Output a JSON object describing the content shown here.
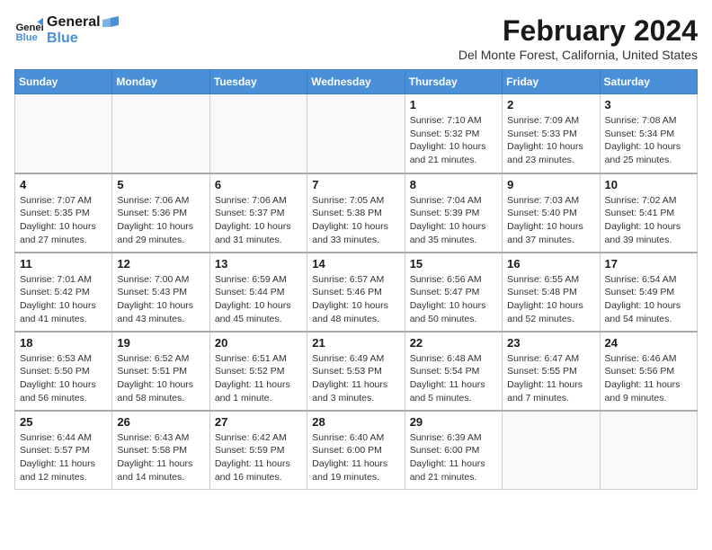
{
  "logo": {
    "line1": "General",
    "line2": "Blue"
  },
  "title": "February 2024",
  "location": "Del Monte Forest, California, United States",
  "weekdays": [
    "Sunday",
    "Monday",
    "Tuesday",
    "Wednesday",
    "Thursday",
    "Friday",
    "Saturday"
  ],
  "weeks": [
    [
      {
        "day": "",
        "info": ""
      },
      {
        "day": "",
        "info": ""
      },
      {
        "day": "",
        "info": ""
      },
      {
        "day": "",
        "info": ""
      },
      {
        "day": "1",
        "info": "Sunrise: 7:10 AM\nSunset: 5:32 PM\nDaylight: 10 hours\nand 21 minutes."
      },
      {
        "day": "2",
        "info": "Sunrise: 7:09 AM\nSunset: 5:33 PM\nDaylight: 10 hours\nand 23 minutes."
      },
      {
        "day": "3",
        "info": "Sunrise: 7:08 AM\nSunset: 5:34 PM\nDaylight: 10 hours\nand 25 minutes."
      }
    ],
    [
      {
        "day": "4",
        "info": "Sunrise: 7:07 AM\nSunset: 5:35 PM\nDaylight: 10 hours\nand 27 minutes."
      },
      {
        "day": "5",
        "info": "Sunrise: 7:06 AM\nSunset: 5:36 PM\nDaylight: 10 hours\nand 29 minutes."
      },
      {
        "day": "6",
        "info": "Sunrise: 7:06 AM\nSunset: 5:37 PM\nDaylight: 10 hours\nand 31 minutes."
      },
      {
        "day": "7",
        "info": "Sunrise: 7:05 AM\nSunset: 5:38 PM\nDaylight: 10 hours\nand 33 minutes."
      },
      {
        "day": "8",
        "info": "Sunrise: 7:04 AM\nSunset: 5:39 PM\nDaylight: 10 hours\nand 35 minutes."
      },
      {
        "day": "9",
        "info": "Sunrise: 7:03 AM\nSunset: 5:40 PM\nDaylight: 10 hours\nand 37 minutes."
      },
      {
        "day": "10",
        "info": "Sunrise: 7:02 AM\nSunset: 5:41 PM\nDaylight: 10 hours\nand 39 minutes."
      }
    ],
    [
      {
        "day": "11",
        "info": "Sunrise: 7:01 AM\nSunset: 5:42 PM\nDaylight: 10 hours\nand 41 minutes."
      },
      {
        "day": "12",
        "info": "Sunrise: 7:00 AM\nSunset: 5:43 PM\nDaylight: 10 hours\nand 43 minutes."
      },
      {
        "day": "13",
        "info": "Sunrise: 6:59 AM\nSunset: 5:44 PM\nDaylight: 10 hours\nand 45 minutes."
      },
      {
        "day": "14",
        "info": "Sunrise: 6:57 AM\nSunset: 5:46 PM\nDaylight: 10 hours\nand 48 minutes."
      },
      {
        "day": "15",
        "info": "Sunrise: 6:56 AM\nSunset: 5:47 PM\nDaylight: 10 hours\nand 50 minutes."
      },
      {
        "day": "16",
        "info": "Sunrise: 6:55 AM\nSunset: 5:48 PM\nDaylight: 10 hours\nand 52 minutes."
      },
      {
        "day": "17",
        "info": "Sunrise: 6:54 AM\nSunset: 5:49 PM\nDaylight: 10 hours\nand 54 minutes."
      }
    ],
    [
      {
        "day": "18",
        "info": "Sunrise: 6:53 AM\nSunset: 5:50 PM\nDaylight: 10 hours\nand 56 minutes."
      },
      {
        "day": "19",
        "info": "Sunrise: 6:52 AM\nSunset: 5:51 PM\nDaylight: 10 hours\nand 58 minutes."
      },
      {
        "day": "20",
        "info": "Sunrise: 6:51 AM\nSunset: 5:52 PM\nDaylight: 11 hours\nand 1 minute."
      },
      {
        "day": "21",
        "info": "Sunrise: 6:49 AM\nSunset: 5:53 PM\nDaylight: 11 hours\nand 3 minutes."
      },
      {
        "day": "22",
        "info": "Sunrise: 6:48 AM\nSunset: 5:54 PM\nDaylight: 11 hours\nand 5 minutes."
      },
      {
        "day": "23",
        "info": "Sunrise: 6:47 AM\nSunset: 5:55 PM\nDaylight: 11 hours\nand 7 minutes."
      },
      {
        "day": "24",
        "info": "Sunrise: 6:46 AM\nSunset: 5:56 PM\nDaylight: 11 hours\nand 9 minutes."
      }
    ],
    [
      {
        "day": "25",
        "info": "Sunrise: 6:44 AM\nSunset: 5:57 PM\nDaylight: 11 hours\nand 12 minutes."
      },
      {
        "day": "26",
        "info": "Sunrise: 6:43 AM\nSunset: 5:58 PM\nDaylight: 11 hours\nand 14 minutes."
      },
      {
        "day": "27",
        "info": "Sunrise: 6:42 AM\nSunset: 5:59 PM\nDaylight: 11 hours\nand 16 minutes."
      },
      {
        "day": "28",
        "info": "Sunrise: 6:40 AM\nSunset: 6:00 PM\nDaylight: 11 hours\nand 19 minutes."
      },
      {
        "day": "29",
        "info": "Sunrise: 6:39 AM\nSunset: 6:00 PM\nDaylight: 11 hours\nand 21 minutes."
      },
      {
        "day": "",
        "info": ""
      },
      {
        "day": "",
        "info": ""
      }
    ]
  ]
}
